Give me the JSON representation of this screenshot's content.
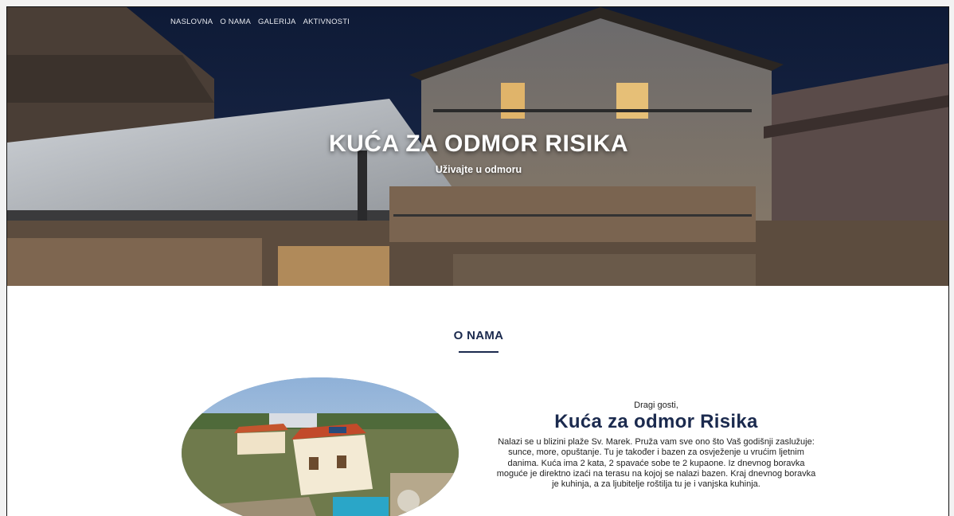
{
  "nav": {
    "items": [
      {
        "label": "NASLOVNA"
      },
      {
        "label": "O NAMA"
      },
      {
        "label": "GALERIJA"
      },
      {
        "label": "AKTIVNOSTI"
      }
    ]
  },
  "hero": {
    "title": "KUĆA ZA ODMOR RISIKA",
    "subtitle": "Uživajte u odmoru"
  },
  "about": {
    "section_title": "O NAMA",
    "greeting": "Dragi gosti,",
    "house_name": "Kuća za odmor Risika",
    "description": "Nalazi se u blizini plaže Sv. Marek. Pruža vam sve ono što Vaš godišnji zaslužuje: sunce, more, opuštanje. Tu je također i bazen za osvježenje u vrućim ljetnim danima. Kuća ima 2 kata, 2 spavaće sobe te 2 kupaone. Iz dnevnog boravka moguće je direktno izaći na terasu na kojoj se nalazi bazen. Kraj dnevnog boravka je kuhinja, a za ljubitelje roštilja tu je i vanjska kuhinja."
  },
  "colors": {
    "accent": "#1b2a4e",
    "hero_night": "#0f1b33"
  }
}
